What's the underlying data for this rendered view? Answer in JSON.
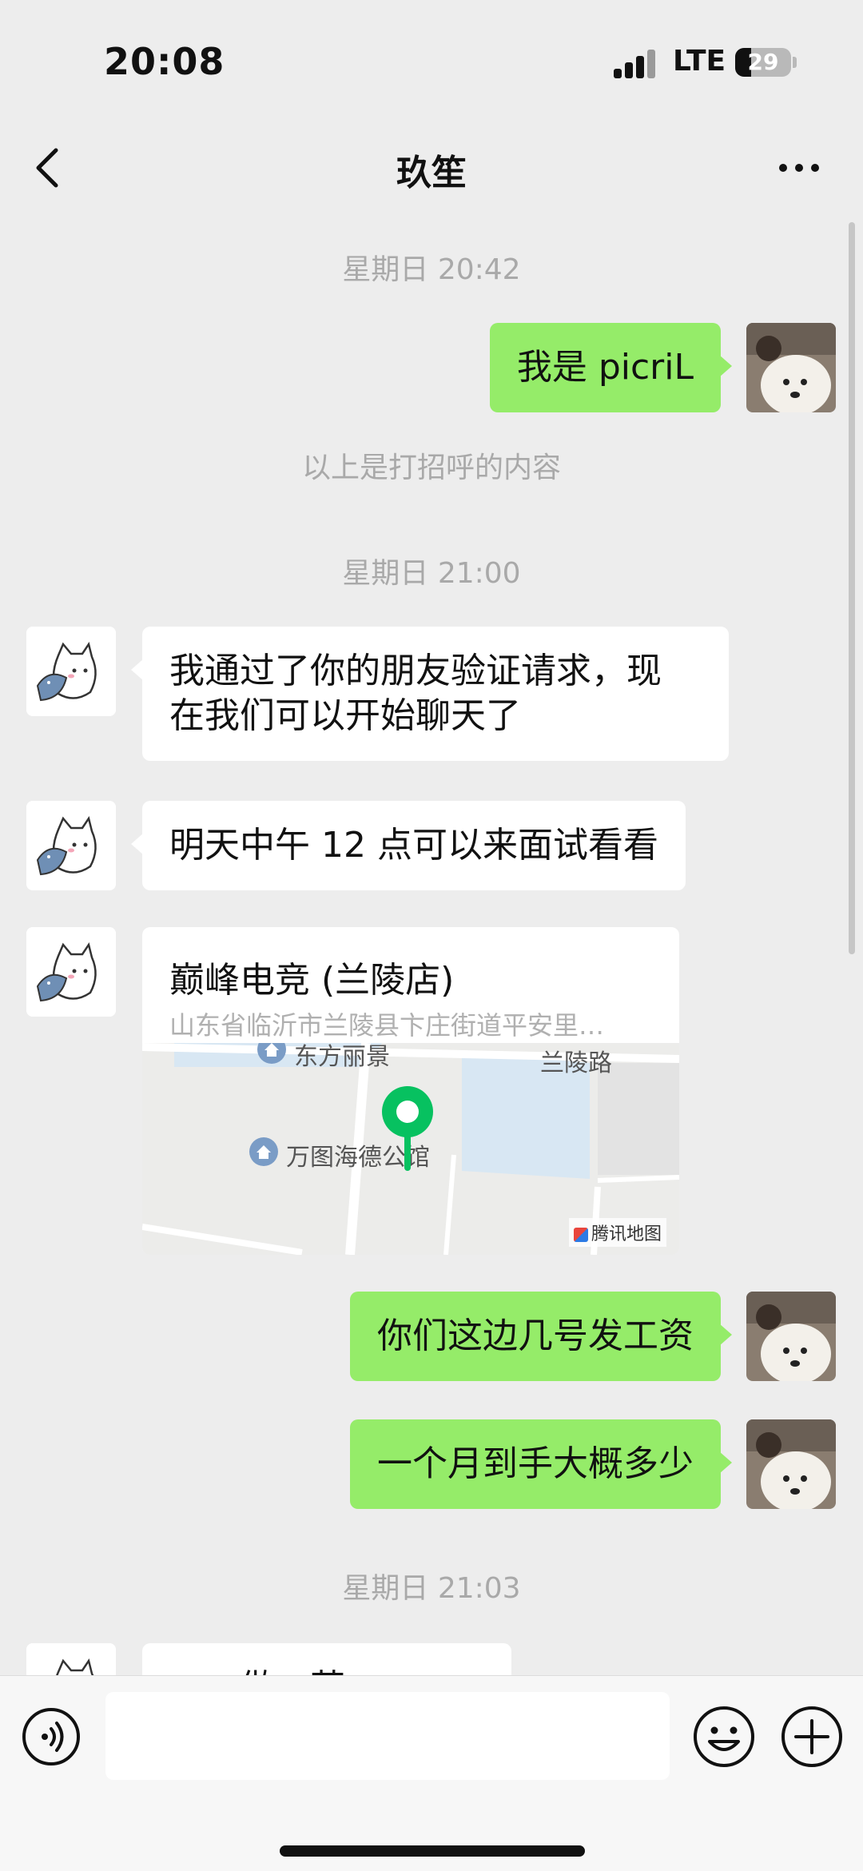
{
  "status_bar": {
    "time": "20:08",
    "network": "LTE",
    "battery": "29",
    "battery_level": 0.29
  },
  "nav": {
    "title": "玖笙",
    "back_icon": "chevron-left-icon",
    "more_icon": "more-icon"
  },
  "messages": {
    "timestamp_1": "星期日 20:42",
    "self_1": "我是 picriL",
    "system_1": "以上是打招呼的内容",
    "timestamp_2": "星期日 21:00",
    "other_1_line1": "我通过了你的朋友验证请求，现",
    "other_1_line2": "在我们可以开始聊天了",
    "other_2": "明天中午 12 点可以来面试看看",
    "location": {
      "name": "巅峰电竞 (兰陵店)",
      "address": "山东省临沂市兰陵县卞庄街道平安里…",
      "map_label_1": "东方丽景",
      "map_label_2": "兰陵路",
      "map_label_3": "万图海德公馆",
      "map_brand": "腾讯地图"
    },
    "self_2": "你们这边几号发工资",
    "self_3": "一个月到手大概多少",
    "timestamp_3": "星期日 21:03",
    "partial": "……做…营…"
  },
  "input_bar": {
    "voice_icon": "voice-icon",
    "input_value": "",
    "emoji_icon": "emoji-icon",
    "plus_icon": "plus-icon"
  },
  "colors": {
    "self_bubble": "#95ec69",
    "other_bubble": "#ffffff",
    "background": "#ededed",
    "map_pin": "#07c160"
  }
}
